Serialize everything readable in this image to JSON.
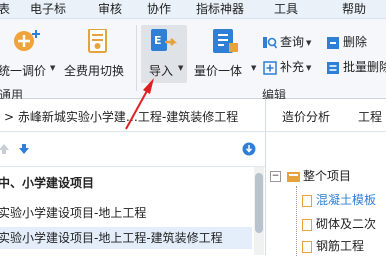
{
  "menubar": {
    "items": [
      "表",
      "电子标",
      "审核",
      "协作",
      "指标神器",
      "工具",
      "帮助"
    ]
  },
  "ribbon": {
    "buttons": {
      "unified_price": "统一调价",
      "apply_all": "全费用切换",
      "import": "导入",
      "quantity_price": "量价一体",
      "query": "查询",
      "supplement": "补充",
      "delete": "删除",
      "batch_delete": "批量删除"
    },
    "groups": {
      "common": "通用",
      "edit": "编辑"
    },
    "accent_color": "#2f7fd6",
    "highlight_color": "#e6a23c"
  },
  "pathbar": {
    "path": "赤峰新城实验小学建…工程-建筑装修工程",
    "tabs": [
      "造价分析",
      "工程"
    ]
  },
  "tree": {
    "items": [
      "中、小学建设项目",
      "实验小学建设项目-地上工程",
      "实验小学建设项目-地上工程-建筑装修工程"
    ]
  },
  "right_tree": {
    "root": "整个项目",
    "items": [
      "混凝土模板",
      "砌体及二次",
      "钢筋工程"
    ]
  },
  "annotation": {
    "arrow_color": "#e02020"
  }
}
